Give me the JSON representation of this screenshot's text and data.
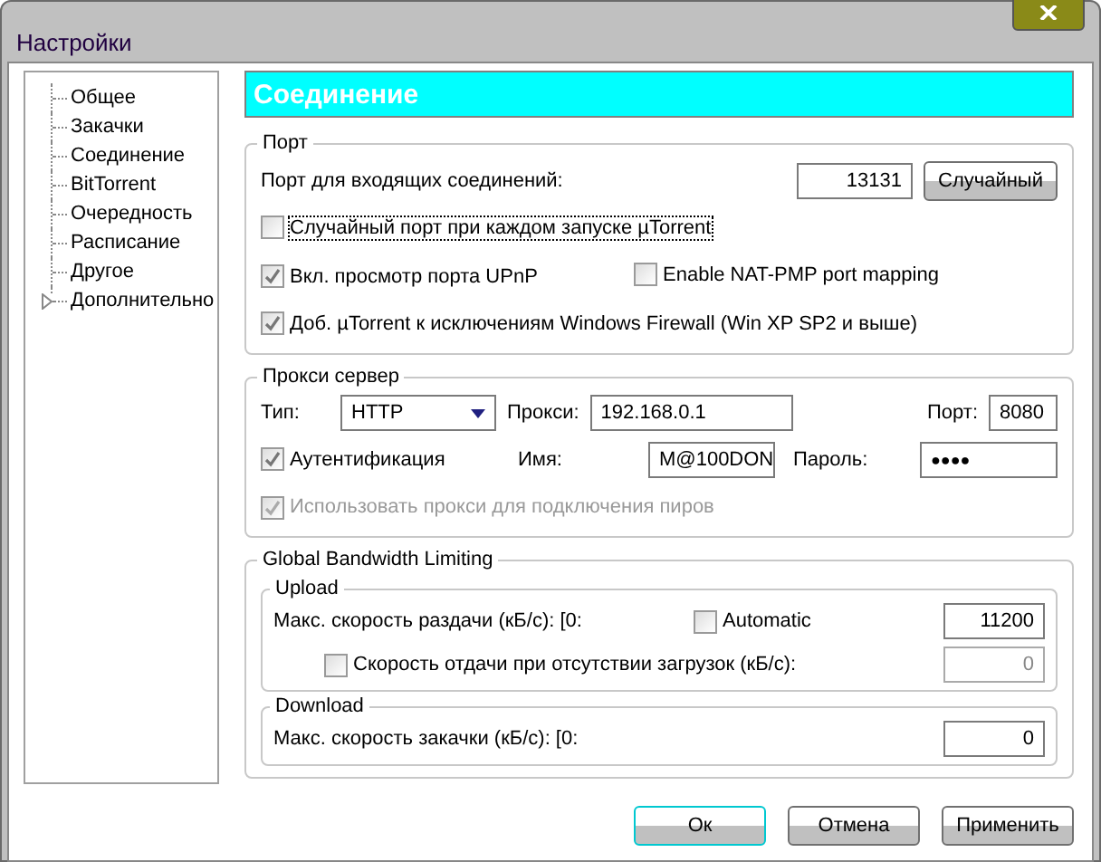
{
  "window": {
    "title": "Настройки"
  },
  "tree": {
    "items": [
      {
        "label": "Общее",
        "expandable": false
      },
      {
        "label": "Закачки",
        "expandable": false
      },
      {
        "label": "Соединение",
        "expandable": false
      },
      {
        "label": "BitTorrent",
        "expandable": false
      },
      {
        "label": "Очередность",
        "expandable": false
      },
      {
        "label": "Расписание",
        "expandable": false
      },
      {
        "label": "Другое",
        "expandable": false
      },
      {
        "label": "Дополнительно",
        "expandable": true
      }
    ]
  },
  "section_title": "Соединение",
  "port_group": {
    "title": "Порт",
    "incoming_label": "Порт для входящих соединений:",
    "incoming_value": "13131",
    "random_button": "Случайный",
    "checkbox_rows": [
      {
        "checkboxes": [
          {
            "label": "Случайный порт при каждом запуске µTorrent",
            "checked": false,
            "focused": true
          }
        ]
      },
      {
        "checkboxes": [
          {
            "label": "Вкл. просмотр порта UPnP",
            "checked": true,
            "focused": false
          },
          {
            "label": "Enable NAT-PMP port mapping",
            "checked": false,
            "focused": false
          }
        ]
      },
      {
        "checkboxes": [
          {
            "label": "Доб. µTorrent к исключениям Windows Firewall (Win XP SP2 и выше)",
            "checked": true,
            "focused": false
          }
        ]
      }
    ]
  },
  "proxy_group": {
    "title": "Прокси сервер",
    "type_label": "Тип:",
    "type_value": "HTTP",
    "proxy_label": "Прокси:",
    "proxy_value": "192.168.0.1",
    "port_label": "Порт:",
    "port_value": "8080",
    "auth": {
      "label": "Аутентификация",
      "checked": true,
      "disabled": false
    },
    "name_label": "Имя:",
    "name_value": "M@100DON",
    "password_label": "Пароль:",
    "password_value": "●●●●",
    "peers": {
      "label": "Использовать прокси для подключения пиров",
      "checked": true,
      "disabled": true
    }
  },
  "bandwidth_group": {
    "title": "Global Bandwidth Limiting",
    "upload": {
      "title": "Upload",
      "max_label": "Макс. скорость раздачи (кБ/с): [0:",
      "automatic": {
        "label": "Automatic",
        "checked": false
      },
      "max_value": "11200",
      "idle": {
        "label": "Скорость отдачи при отсутствии загрузок (кБ/с):",
        "checked": false
      },
      "idle_value": {
        "value": "0",
        "disabled": true
      }
    },
    "download": {
      "title": "Download",
      "max_label": "Макс. скорость закачки (кБ/с): [0:",
      "max_value": "0"
    }
  },
  "buttons": [
    {
      "label": "Ок",
      "default": true
    },
    {
      "label": "Отмена",
      "default": false
    },
    {
      "label": "Применить",
      "default": false
    }
  ]
}
